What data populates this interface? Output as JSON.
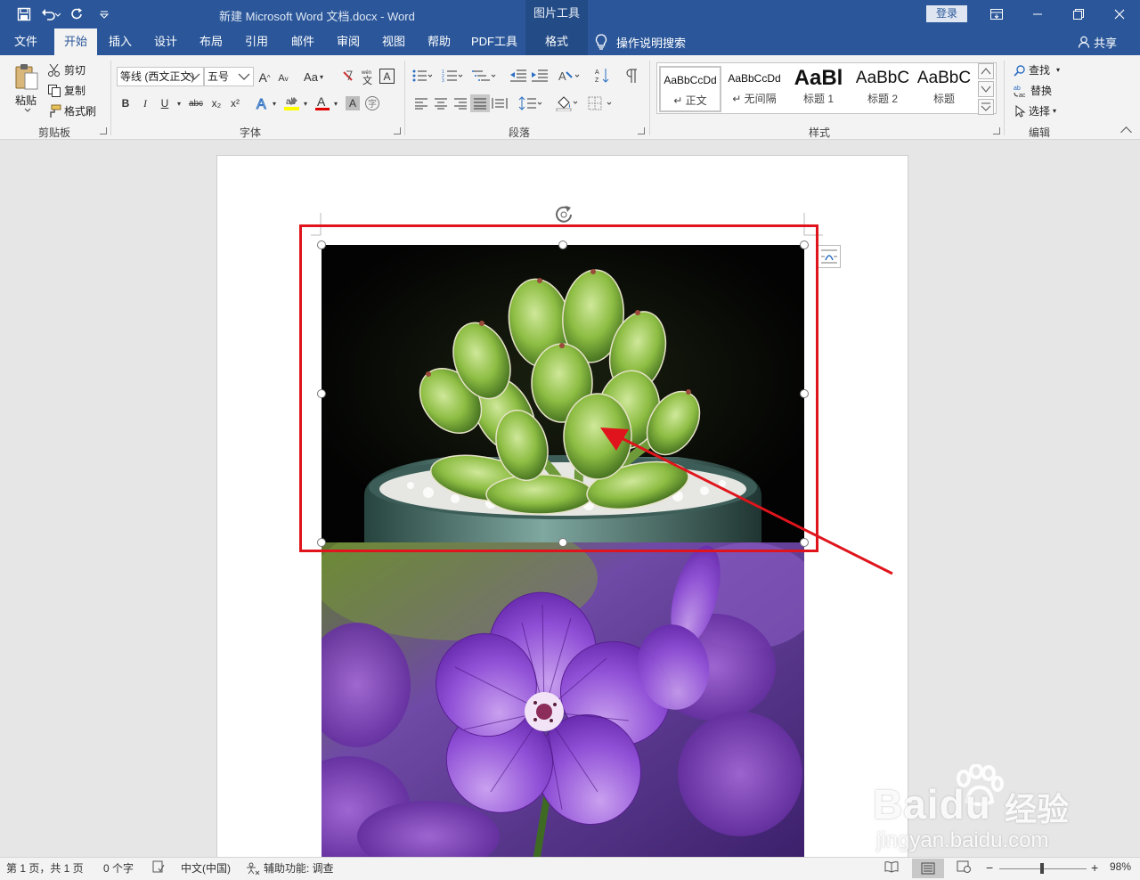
{
  "window": {
    "title": "新建 Microsoft Word 文档.docx  -  Word",
    "contextual_tab_group": "图片工具",
    "login_label": "登录"
  },
  "tabs": {
    "items": [
      "文件",
      "开始",
      "插入",
      "设计",
      "布局",
      "引用",
      "邮件",
      "审阅",
      "视图",
      "帮助",
      "PDF工具",
      "格式"
    ],
    "active": "开始",
    "search_label": "操作说明搜索",
    "share_label": "共享"
  },
  "clipboard": {
    "paste_label": "粘贴",
    "cut_label": "剪切",
    "copy_label": "复制",
    "format_painter_label": "格式刷",
    "group_label": "剪贴板"
  },
  "font": {
    "font_name": "等线 (西文正文)",
    "font_size": "五号",
    "group_label": "字体",
    "change_case": "Aa",
    "bold": "B",
    "italic": "I",
    "underline": "U",
    "strikethrough": "abc",
    "subscript": "x₂",
    "superscript": "x²",
    "grow_font": "A",
    "shrink_font": "A"
  },
  "paragraph": {
    "group_label": "段落"
  },
  "styles": {
    "group_label": "样式",
    "items": [
      {
        "sample": "AaBbCcDd",
        "name": "↵ 正文"
      },
      {
        "sample": "AaBbCcDd",
        "name": "↵ 无间隔"
      },
      {
        "sample": "AaBl",
        "name": "标题 1"
      },
      {
        "sample": "AaBbC",
        "name": "标题 2"
      },
      {
        "sample": "AaBbC",
        "name": "标题"
      }
    ]
  },
  "editing": {
    "find_label": "查找",
    "replace_label": "替换",
    "select_label": "选择",
    "group_label": "编辑"
  },
  "watermark": {
    "brand": "Bai",
    "brand2": "du",
    "brand_cn": "经验",
    "url": "jingyan.baidu.com"
  },
  "status": {
    "page_info": "第 1 页，共 1 页",
    "word_count": "0 个字",
    "language": "中文(中国)",
    "accessibility": "辅助功能: 调查",
    "zoom": "98%",
    "zoom_level": 0.49
  },
  "colors": {
    "brand_blue": "#2b579a",
    "annotation_red": "#e0141c",
    "highlight_yellow": "#ffff00",
    "font_color_red": "#e00000"
  }
}
